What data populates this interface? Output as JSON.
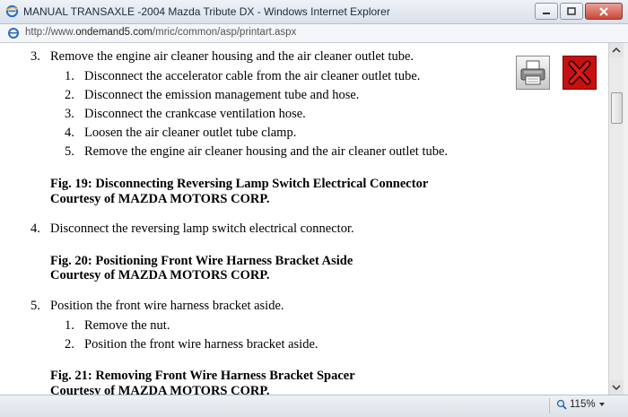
{
  "window": {
    "title": "MANUAL TRANSAXLE -2004 Mazda Tribute DX - Windows Internet Explorer",
    "url_prefix": "http://www.",
    "url_domain": "ondemand5.com",
    "url_path": "/mric/common/asp/printart.aspx"
  },
  "content": {
    "step3": {
      "num": "3.",
      "text": "Remove the engine air cleaner housing and the air cleaner outlet tube.",
      "substeps": [
        {
          "num": "1.",
          "text": "Disconnect the accelerator cable from the air cleaner outlet tube."
        },
        {
          "num": "2.",
          "text": "Disconnect the emission management tube and hose."
        },
        {
          "num": "3.",
          "text": "Disconnect the crankcase ventilation hose."
        },
        {
          "num": "4.",
          "text": "Loosen the air cleaner outlet tube clamp."
        },
        {
          "num": "5.",
          "text": "Remove the engine air cleaner housing and the air cleaner outlet tube."
        }
      ]
    },
    "fig19": {
      "caption": "Fig. 19: Disconnecting Reversing Lamp Switch Electrical Connector",
      "courtesy": "Courtesy of MAZDA MOTORS CORP."
    },
    "step4": {
      "num": "4.",
      "text": "Disconnect the reversing lamp switch electrical connector."
    },
    "fig20": {
      "caption": "Fig. 20: Positioning Front Wire Harness Bracket Aside",
      "courtesy": "Courtesy of MAZDA MOTORS CORP."
    },
    "step5": {
      "num": "5.",
      "text": "Position the front wire harness bracket aside.",
      "substeps": [
        {
          "num": "1.",
          "text": "Remove the nut."
        },
        {
          "num": "2.",
          "text": "Position the front wire harness bracket aside."
        }
      ]
    },
    "fig21": {
      "caption": "Fig. 21: Removing Front Wire Harness Bracket Spacer",
      "courtesy": "Courtesy of MAZDA MOTORS CORP."
    }
  },
  "status": {
    "zoom": "115%"
  },
  "icons": {
    "print": "printer-icon",
    "close": "close-x-icon",
    "zoom": "magnifier-icon"
  },
  "colors": {
    "close_red": "#c81010",
    "link_blue": "#1e57a4"
  }
}
